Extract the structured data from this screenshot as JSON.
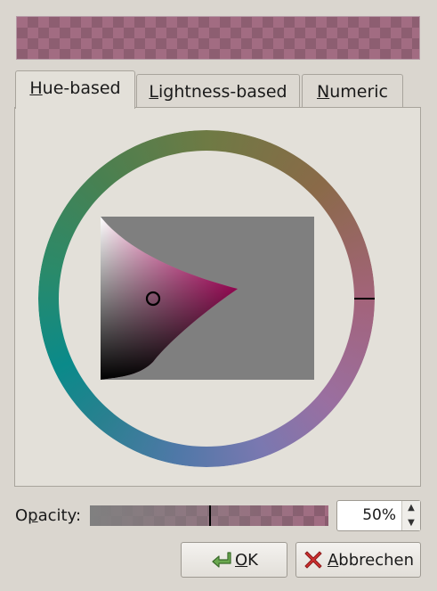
{
  "tabs": [
    {
      "label": "Hue-based",
      "mnemonic": "H",
      "rest": "ue-based",
      "active": true
    },
    {
      "label": "Lightness-based",
      "mnemonic": "L",
      "rest": "ightness-based",
      "active": false
    },
    {
      "label": "Numeric",
      "mnemonic": "N",
      "rest": "umeric",
      "active": false
    }
  ],
  "selected_color": "#a26c82",
  "hue_ring": {
    "selected_hue_color": "#a3637a"
  },
  "triangle": {
    "pure_hue_color": "#ff0a8c",
    "background": "#7f7f7f"
  },
  "opacity": {
    "label_prefix": "O",
    "label_mnemonic": "p",
    "label_rest": "acity:",
    "value_text": "50%",
    "value": 0.5
  },
  "buttons": {
    "ok": {
      "mnemonic": "O",
      "rest": "K",
      "icon": "ok-arrow-icon"
    },
    "cancel": {
      "mnemonic": "A",
      "rest": "bbrechen",
      "icon": "cancel-x-icon"
    }
  }
}
